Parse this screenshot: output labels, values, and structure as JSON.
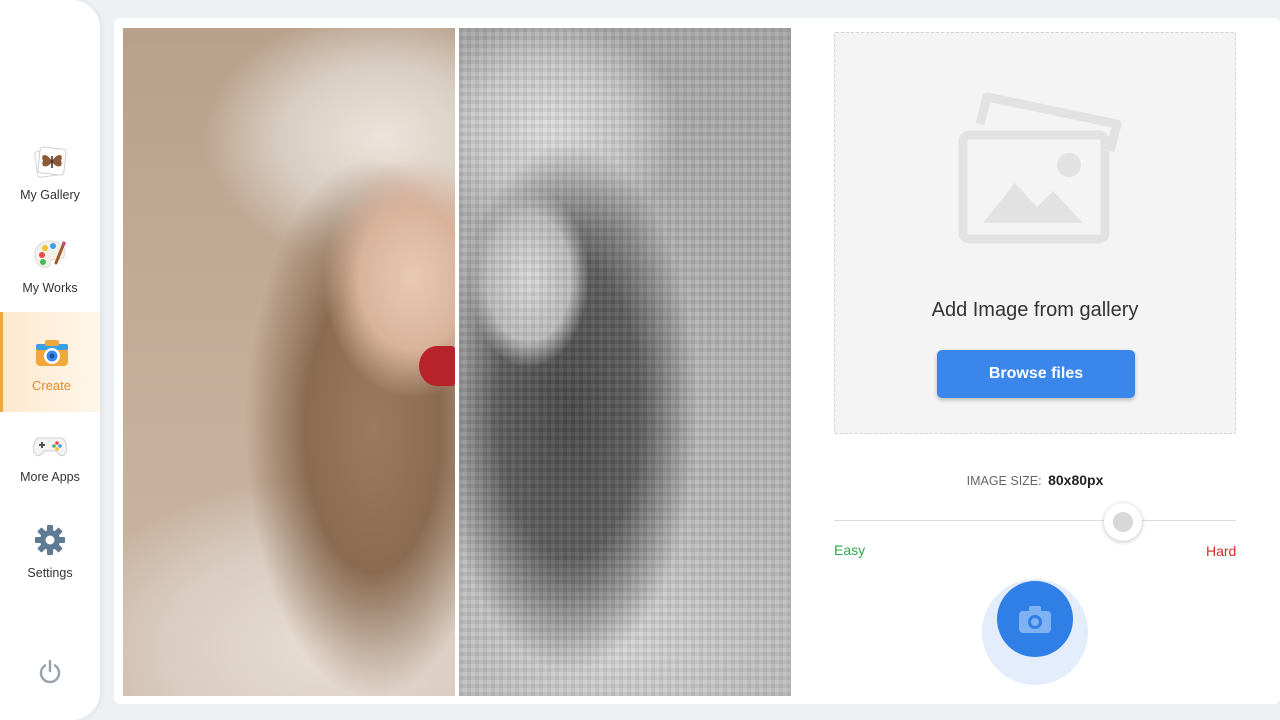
{
  "sidebar": {
    "items": [
      {
        "label": "My Gallery",
        "icon": "gallery-butterfly-icon"
      },
      {
        "label": "My Works",
        "icon": "palette-icon"
      },
      {
        "label": "Create",
        "icon": "camera-icon",
        "active": true
      },
      {
        "label": "More Apps",
        "icon": "gamepad-icon"
      },
      {
        "label": "Settings",
        "icon": "gear-icon"
      }
    ],
    "power_icon": "power-icon"
  },
  "upload": {
    "prompt": "Add Image from gallery",
    "button_label": "Browse files"
  },
  "image_size": {
    "label": "IMAGE SIZE:",
    "value": "80x80px"
  },
  "difficulty": {
    "min_label": "Easy",
    "max_label": "Hard",
    "level": 0.77
  },
  "colors": {
    "accent": "#3a86ea",
    "active_nav": "#f2a548",
    "easy": "#2ea84a",
    "hard": "#d42a2a"
  }
}
